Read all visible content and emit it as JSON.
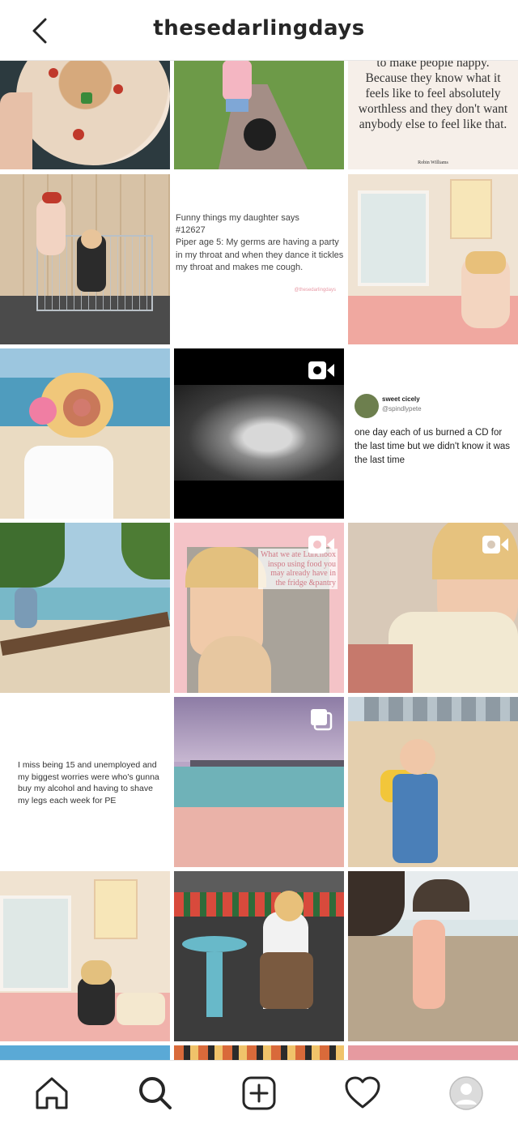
{
  "header": {
    "title": "thesedarlingdays",
    "back_icon": "chevron-left-icon"
  },
  "posts": {
    "quote_top": {
      "text": "to make people happy. Because they know what it feels like to feel absolutely worthless and they don't want anybody else to feel like that.",
      "author": "Robin Williams"
    },
    "funny_things": {
      "line1": "Funny things my daughter says",
      "line2": "#12627",
      "line3": "Piper age 5: My germs are having a party in my throat and when they dance it tickles my throat and makes me cough.",
      "handle": "@thesedarlingdays"
    },
    "tweet": {
      "name": "sweet cicely",
      "handle": "@spindlypete",
      "text": "one day each of us burned a CD for the last time but we didn't know it was the last time"
    },
    "lunchbox": {
      "text": "What we ate Lunchbox inspo using food you may already have in the fridge &pantry"
    },
    "miss15": {
      "text": "I miss being 15 and unemployed and my biggest worries were who's gunna buy my alcohol and having to shave my legs each week for PE"
    }
  },
  "nav": {
    "items": [
      {
        "icon": "home-icon"
      },
      {
        "icon": "search-icon"
      },
      {
        "icon": "add-post-icon"
      },
      {
        "icon": "heart-icon"
      },
      {
        "icon": "profile-avatar-icon"
      }
    ]
  },
  "colors": {
    "text": "#262626",
    "divider": "#e6e6e6"
  }
}
